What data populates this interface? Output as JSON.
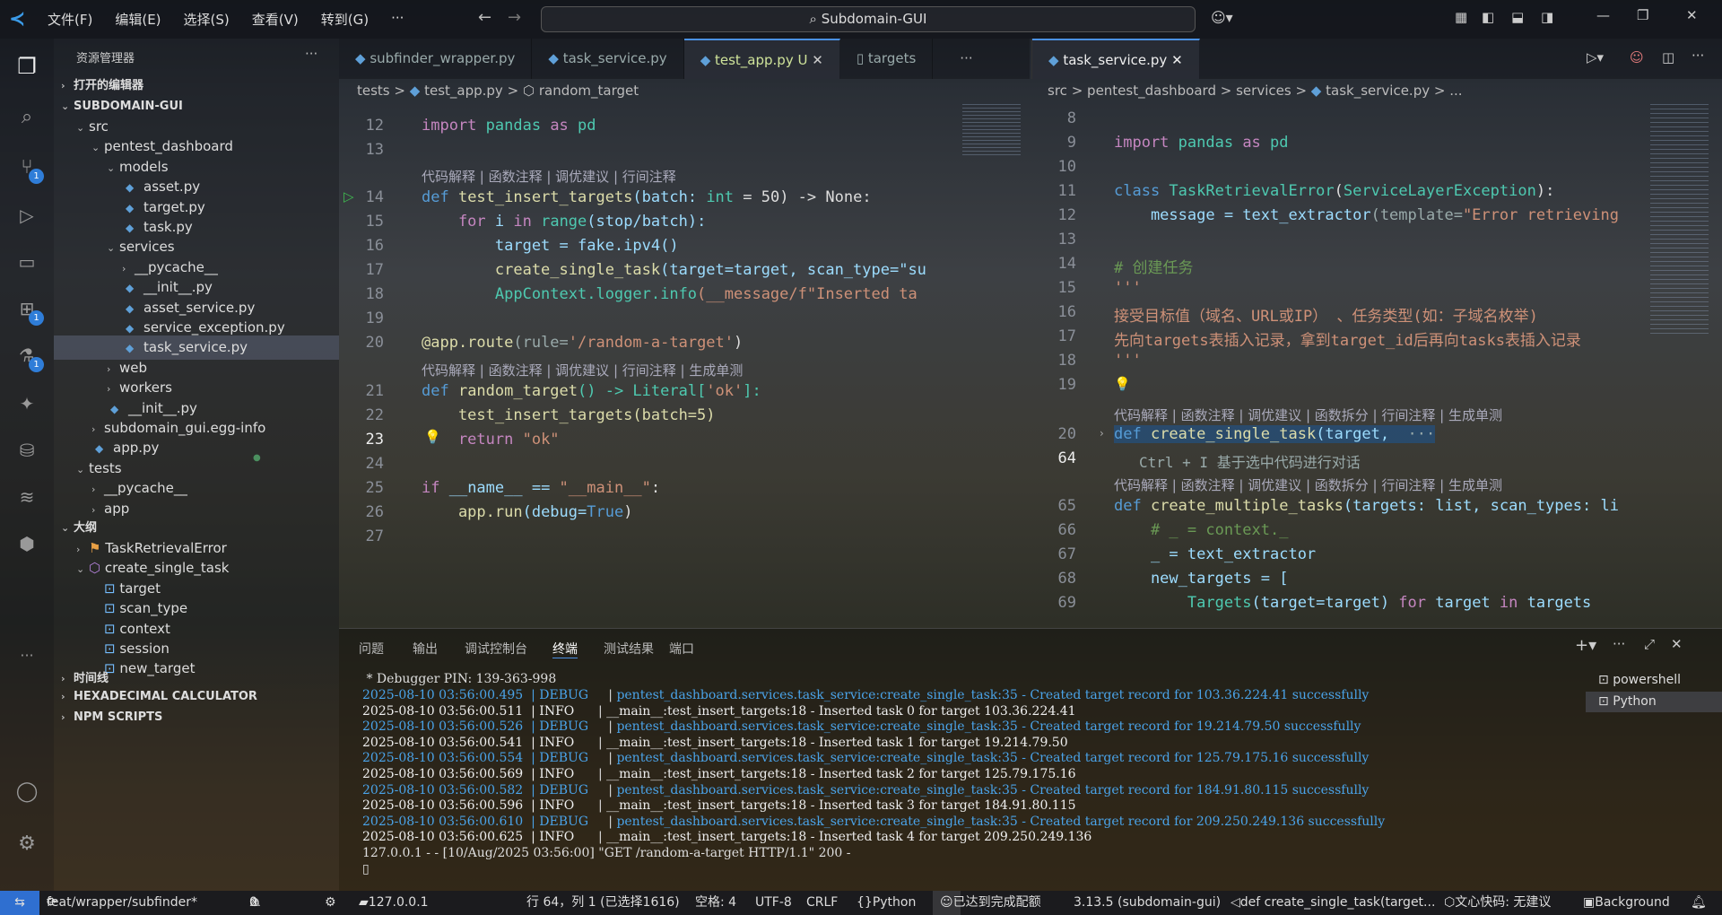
{
  "title": {
    "menu": [
      "文件(F)",
      "编辑(E)",
      "选择(S)",
      "查看(V)",
      "转到(G)",
      "···"
    ],
    "search": "Subdomain-GUI"
  },
  "activity": {
    "badges": [
      "1",
      "1",
      "1"
    ]
  },
  "explorer": {
    "header": "资源管理器",
    "open_editors": "打开的编辑器",
    "project": "SUBDOMAIN-GUI",
    "tree": [
      {
        "label": "src",
        "indent": 1,
        "type": "folder",
        "open": true
      },
      {
        "label": "pentest_dashboard",
        "indent": 2,
        "type": "folder",
        "open": true
      },
      {
        "label": "models",
        "indent": 3,
        "type": "folder",
        "open": true
      },
      {
        "label": "asset.py",
        "indent": 4,
        "type": "py"
      },
      {
        "label": "target.py",
        "indent": 4,
        "type": "py"
      },
      {
        "label": "task.py",
        "indent": 4,
        "type": "py"
      },
      {
        "label": "services",
        "indent": 3,
        "type": "folder",
        "open": true
      },
      {
        "label": "__pycache__",
        "indent": 4,
        "type": "folder",
        "open": false
      },
      {
        "label": "__init__.py",
        "indent": 4,
        "type": "py"
      },
      {
        "label": "asset_service.py",
        "indent": 4,
        "type": "py"
      },
      {
        "label": "service_exception.py",
        "indent": 4,
        "type": "py"
      },
      {
        "label": "task_service.py",
        "indent": 4,
        "type": "py",
        "selected": true
      },
      {
        "label": "web",
        "indent": 3,
        "type": "folder",
        "open": false
      },
      {
        "label": "workers",
        "indent": 3,
        "type": "folder",
        "open": false
      },
      {
        "label": "__init__.py",
        "indent": 3,
        "type": "py"
      },
      {
        "label": "subdomain_gui.egg-info",
        "indent": 2,
        "type": "folder",
        "open": false
      },
      {
        "label": "app.py",
        "indent": 2,
        "type": "py"
      },
      {
        "label": "tests",
        "indent": 1,
        "type": "folder",
        "open": true
      },
      {
        "label": "__pycache__",
        "indent": 2,
        "type": "folder",
        "open": false
      },
      {
        "label": "app",
        "indent": 2,
        "type": "folder",
        "open": false
      }
    ],
    "outline": "大纲",
    "outline_items": [
      {
        "label": "TaskRetrievalError",
        "indent": 1,
        "open": false,
        "icon": "class"
      },
      {
        "label": "create_single_task",
        "indent": 1,
        "open": true,
        "icon": "func"
      },
      {
        "label": "target",
        "indent": 2,
        "icon": "var"
      },
      {
        "label": "scan_type",
        "indent": 2,
        "icon": "var"
      },
      {
        "label": "context",
        "indent": 2,
        "icon": "var"
      },
      {
        "label": "session",
        "indent": 2,
        "icon": "var"
      },
      {
        "label": "new_target",
        "indent": 2,
        "icon": "var"
      }
    ],
    "timeline": "时间线",
    "hexcalc": "HEXADECIMAL CALCULATOR",
    "npm": "NPM SCRIPTS"
  },
  "editor_left": {
    "tabs": [
      "subfinder_wrapper.py",
      "task_service.py",
      "test_app.py U",
      "targets"
    ],
    "breadcrumb": [
      "tests",
      ">",
      "test_app.py",
      ">",
      "random_target"
    ],
    "lens1": "代码解释 | 函数注释 | 调优建议 | 行间注释",
    "lens2": "代码解释 | 函数注释 | 调优建议 | 行间注释 | 生成单测",
    "lines": [
      "12",
      "13",
      "14",
      "15",
      "16",
      "17",
      "18",
      "19",
      "20",
      "21",
      "22",
      "23",
      "24",
      "25",
      "26",
      "27"
    ],
    "code": {
      "l12a": "import",
      "l12b": " pandas ",
      "l12c": "as",
      "l12d": " pd",
      "l14a": "def ",
      "l14b": "test_insert_targets",
      "l14c": "(batch: ",
      "l14d": "int",
      " l14e": "",
      "l14rest": " = 50) -> None:",
      "l15a": "    for ",
      "l15b": "i ",
      "l15c": "in ",
      "l15d": "range",
      "l15e": "(stop/batch):",
      "l16": "        target = fake.ipv4()",
      "l17a": "        create_single_task",
      "l17b": "(target=target, scan_type=\"su",
      "l18a": "        AppContext.logger.info",
      "l18b": "(__message/f\"Inserted ta",
      "l20a": "@app.route",
      "l20b": "(rule=",
      "l20c": "'/random-a-target'",
      "l20d": ")",
      "l21a": "def ",
      "l21b": "random_target",
      "l21c": "() -> Literal[",
      "l21d": "'ok'",
      "l21e": "]:",
      "l22": "    test_insert_targets(batch=5)",
      "l23a": "    return ",
      "l23b": "\"ok\"",
      "l25a": "if ",
      "l25b": "__name__ == ",
      "l25c": "\"__main__\"",
      "l25d": ":",
      "l26a": "    app.run",
      "l26b": "(debug=",
      "l26c": "True",
      "l26d": ")"
    }
  },
  "editor_right": {
    "tab": "task_service.py",
    "breadcrumb": [
      "src",
      ">",
      "pentest_dashboard",
      ">",
      "services",
      ">",
      "task_service.py",
      ">",
      "..."
    ],
    "lines": [
      "8",
      "9",
      "10",
      "11",
      "12",
      "13",
      "14",
      "15",
      "16",
      "17",
      "18",
      "19",
      "20",
      "64",
      "65",
      "66",
      "67",
      "68",
      "69"
    ],
    "lens": "代码解释 | 函数注释 | 调优建议 | 函数拆分 | 行间注释 | 生成单测",
    "hint": "Ctrl + I 基于选中代码进行对话",
    "code": {
      "l9a": "import",
      "l9b": " pandas ",
      "l9c": "as",
      "l9d": " pd",
      "l11a": "class ",
      "l11b": "TaskRetrievalError",
      "l11c": "(",
      "l11d": "ServiceLayerException",
      "l11e": "):",
      "l12a": "    message = text_extractor",
      "l12b": "(template=",
      "l12c": "\"Error retrieving",
      "l14": "# 创建任务",
      "l15": "'''",
      "l16": "接受目标值（域名、URL或IP） 、任务类型(如：子域名枚举)",
      "l17": "先向targets表插入记录，拿到target_id后再向tasks表插入记录",
      "l18": "'''",
      "l20a": "def ",
      "l20b": "create_single_task",
      "l20c": "(target, ",
      "l65a": "def ",
      "l65b": "create_multiple_tasks",
      "l65c": "(targets: list, scan_types: li",
      "l66": "    # _ = context._",
      "l67": "    _ = text_extractor",
      "l68": "    new_targets = [",
      "l69a": "        Targets",
      "l69b": "(target=target) ",
      "l69c": "for ",
      "l69d": "target ",
      "l69e": "in ",
      "l69f": "targets"
    }
  },
  "panel": {
    "tabs": [
      "问题",
      "输出",
      "调试控制台",
      "终端",
      "测试结果",
      "端口"
    ],
    "terminals": [
      "powershell",
      "Python"
    ],
    "pin": " * Debugger PIN: 139-363-998",
    "logs": [
      {
        "t": "2025-08-10 03:56:00.495",
        "lv": "DEBUG",
        "src": "pentest_dashboard.services.task_service:create_single_task:35",
        "msg": " - Created target record for 103.36.224.41 successfully"
      },
      {
        "t": "2025-08-10 03:56:00.511",
        "lv": "INFO",
        "src": "__main__:test_insert_targets:18",
        "msg": " - Inserted task 0 for target 103.36.224.41"
      },
      {
        "t": "2025-08-10 03:56:00.526",
        "lv": "DEBUG",
        "src": "pentest_dashboard.services.task_service:create_single_task:35",
        "msg": " - Created target record for 19.214.79.50 successfully"
      },
      {
        "t": "2025-08-10 03:56:00.541",
        "lv": "INFO",
        "src": "__main__:test_insert_targets:18",
        "msg": " - Inserted task 1 for target 19.214.79.50"
      },
      {
        "t": "2025-08-10 03:56:00.554",
        "lv": "DEBUG",
        "src": "pentest_dashboard.services.task_service:create_single_task:35",
        "msg": " - Created target record for 125.79.175.16 successfully"
      },
      {
        "t": "2025-08-10 03:56:00.569",
        "lv": "INFO",
        "src": "__main__:test_insert_targets:18",
        "msg": " - Inserted task 2 for target 125.79.175.16"
      },
      {
        "t": "2025-08-10 03:56:00.582",
        "lv": "DEBUG",
        "src": "pentest_dashboard.services.task_service:create_single_task:35",
        "msg": " - Created target record for 184.91.80.115 successfully"
      },
      {
        "t": "2025-08-10 03:56:00.596",
        "lv": "INFO",
        "src": "__main__:test_insert_targets:18",
        "msg": " - Inserted task 3 for target 184.91.80.115"
      },
      {
        "t": "2025-08-10 03:56:00.610",
        "lv": "DEBUG",
        "src": "pentest_dashboard.services.task_service:create_single_task:35",
        "msg": " - Created target record for 209.250.249.136 successfully"
      },
      {
        "t": "2025-08-10 03:56:00.625",
        "lv": "INFO",
        "src": "__main__:test_insert_targets:18",
        "msg": " - Inserted task 4 for target 209.250.249.136"
      }
    ],
    "request": "127.0.0.1 - - [10/Aug/2025 03:56:00] \"GET /random-a-target HTTP/1.1\" 200 -"
  },
  "status": {
    "branch": "feat/wrapper/subfinder*",
    "errors": "0",
    "warnings": "0",
    "host": "127.0.0.1",
    "position": "行 64，列 1 (已选择1616)",
    "spaces": "空格: 4",
    "encoding": "UTF-8",
    "eol": "CRLF",
    "lang": "Python",
    "quota": "已达到完成配额",
    "interp": "3.13.5 (subdomain-gui)",
    "symbol": "def create_single_task(target...",
    "wenxin": "文心快码: 无建议",
    "bg": "Background"
  }
}
